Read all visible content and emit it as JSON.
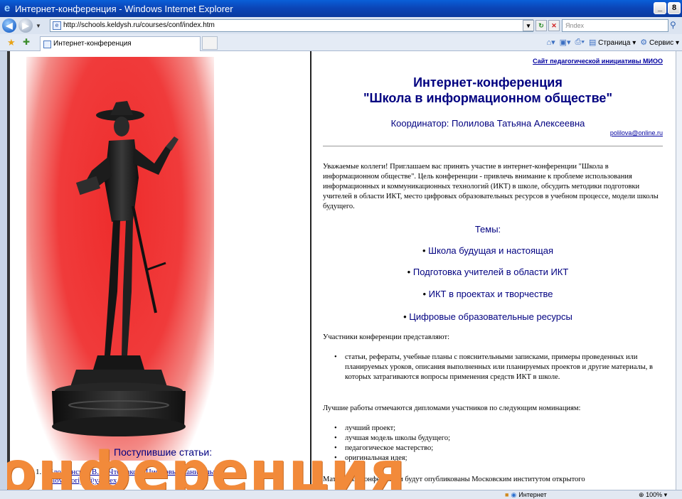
{
  "window": {
    "title": "Интернет-конференция - Windows Internet Explorer",
    "min": "_",
    "max": "8"
  },
  "address": {
    "url": "http://schools.keldysh.ru/courses/conf/index.htm",
    "search_placeholder": "Яndex"
  },
  "tabs": {
    "active_label": "Интернет-конференция"
  },
  "commandbar": {
    "page_label": "Страница",
    "tools_label": "Сервис"
  },
  "left": {
    "posted_title": "Поступившие статьи:",
    "articles": [
      {
        "num": "1.",
        "title": "Блощинская В.О. Что такое \"Цифровые каникулы\"?",
        "email": "bloviktoriya@yandex.ru"
      }
    ]
  },
  "right": {
    "miio_link": "Сайт педагогической инициативы МИОО",
    "title_line1": "Интернет-конференция",
    "title_line2": "\"Школа в информационном обществе\"",
    "coordinator": "Координатор: Полилова Татьяна Алексеевна",
    "email": "polilova@online.ru",
    "intro": "Уважаемые коллеги! Приглашаем вас принять участие в интернет-конференции \"Школа в информационном обществе\". Цель конференции - привлечь внимание к проблеме использования информационных и коммуникационных технологий (ИКТ) в школе, обсудить методики подготовки учителей в области ИКТ, место цифровых образовательных ресурсов в учебном процессе, модели школы будущего.",
    "themes_title": "Темы:",
    "themes": [
      "Школа будущая и настоящая",
      "Подготовка учителей в области ИКТ",
      "ИКТ в проектах и творчестве",
      "Цифровые образовательные ресурсы"
    ],
    "participants_intro": "Участники конференции представляют:",
    "participants_item": "статьи, рефераты, учебные планы с пояснительными записками, примеры проведенных или планируемых уроков, описания выполненных или планируемых проектов и другие материалы, в которых затрагиваются вопросы применения средств ИКТ в школе.",
    "best_intro": "Лучшие работы отмечаются дипломами участников по следующим номинациям:",
    "nominations": [
      "лучший проект;",
      "лучшая модель школы будущего;",
      "педагогическое мастерство;",
      "оригинальная идея;"
    ],
    "materials": "Материалы конференции будут опубликованы Московским институтом открытого"
  },
  "overlay": {
    "word": "онференция"
  },
  "status": {
    "zone": "Интернет",
    "zoom": "100%"
  }
}
